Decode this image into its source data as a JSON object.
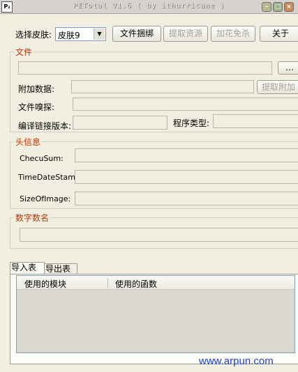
{
  "window": {
    "title": "PETotal V1.6 ( by ithurricane )",
    "icon_label": "P₂"
  },
  "toolbar": {
    "skin_label": "选择皮肤:",
    "skin_value": "皮肤9",
    "btn_bind": "文件捆绑",
    "btn_extract": "提取资源",
    "btn_pack": "加花免杀",
    "btn_about": "关于"
  },
  "file_group": {
    "title": "文件",
    "append_label": "附加数据:",
    "extract_append_btn": "提取附加",
    "sniff_label": "文件嗅探:",
    "linker_label": "编译链接版本:",
    "program_type_label": "程序类型:"
  },
  "header_group": {
    "title": "头信息",
    "checksum_label": "ChecuSum:",
    "timestamp_label": "TimeDateStamp:",
    "sizeofimage_label": "SizeOfImage:"
  },
  "digsig_group": {
    "title": "数字数名"
  },
  "tabs": {
    "import": "导入表",
    "export": "导出表"
  },
  "listview": {
    "col_module": "使用的模块",
    "col_function": "使用的函数"
  },
  "watermark": "www.arpun.com",
  "colors": {
    "group_title": "#cc3300",
    "watermark": "#1b3fd7"
  }
}
